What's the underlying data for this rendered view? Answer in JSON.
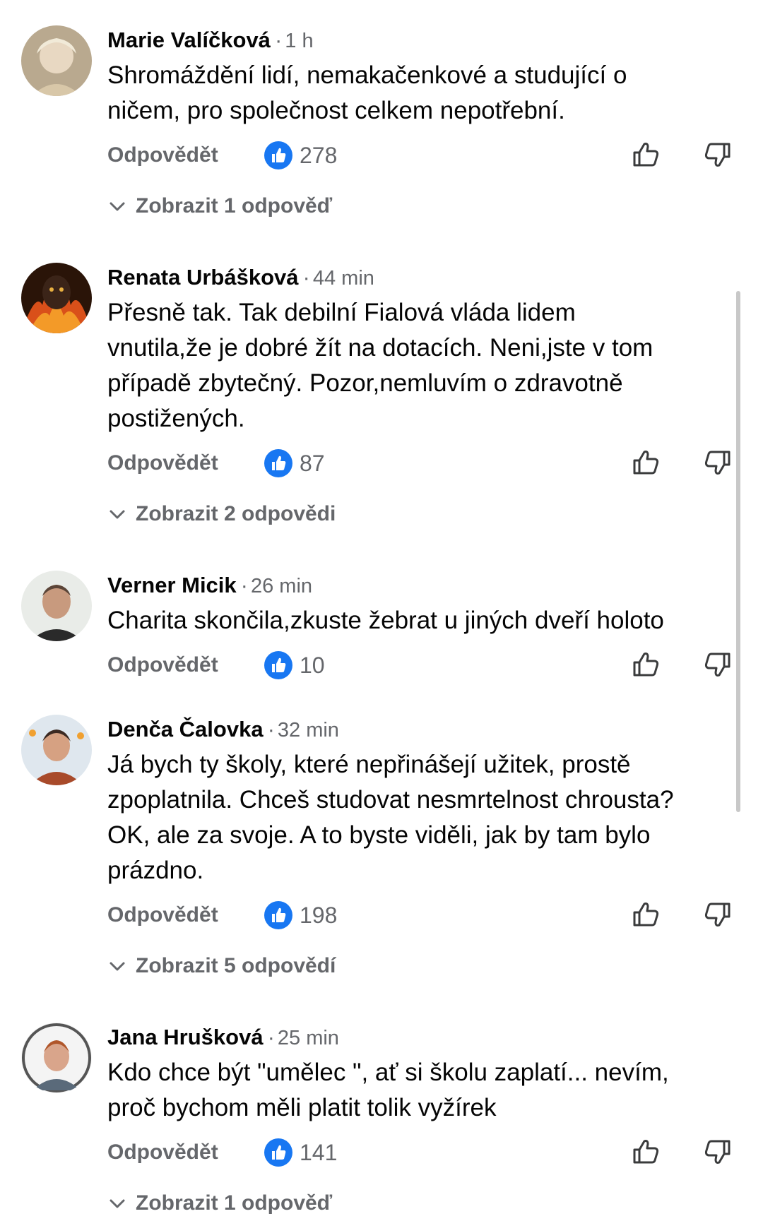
{
  "comments": [
    {
      "author": "Marie Valíčková",
      "time": "1 h",
      "text": "Shromáždění lidí, nemakačenkové a studující o\nničem, pro společnost celkem nepotřební.",
      "reply_label": "Odpovědět",
      "likes": "278",
      "replies_label": "Zobrazit 1 odpověď"
    },
    {
      "author": "Renata Urbášková",
      "time": "44 min",
      "text": "Přesně tak. Tak debilní Fialová vláda lidem\nvnutila,že je dobré žít na dotacích. Neni,jste v tom\npřípadě zbytečný. Pozor,nemluvím o zdravotně\npostižených.",
      "reply_label": "Odpovědět",
      "likes": "87",
      "replies_label": "Zobrazit 2 odpovědi"
    },
    {
      "author": "Verner Micik",
      "time": "26 min",
      "text": "Charita skončila,zkuste žebrat u jiných dveří holoto",
      "reply_label": "Odpovědět",
      "likes": "10",
      "replies_label": ""
    },
    {
      "author": "Denča Čalovka",
      "time": "32 min",
      "text": "Já bych ty školy, které nepřinášejí užitek, prostě\nzpoplatnila. Chceš studovat nesmrtelnost chrousta?\nOK, ale za svoje. A to byste viděli, jak by tam bylo\nprázdno.",
      "reply_label": "Odpovědět",
      "likes": "198",
      "replies_label": "Zobrazit 5 odpovědí"
    },
    {
      "author": "Jana Hrušková",
      "time": "25 min",
      "text": "Kdo chce být \"umělec \", ať si školu zaplatí... nevím,\nproč bychom měli platit tolik vyžírek",
      "reply_label": "Odpovědět",
      "likes": "141",
      "replies_label": "Zobrazit 1 odpověď"
    }
  ],
  "icons": {
    "like_badge": "thumbs-up-filled-icon",
    "like_button": "thumbs-up-outline-icon",
    "dislike_button": "thumbs-down-outline-icon",
    "expand": "chevron-down-icon"
  },
  "colors": {
    "accent": "#1877f2",
    "secondary_text": "#65676b",
    "primary_text": "#050505"
  }
}
